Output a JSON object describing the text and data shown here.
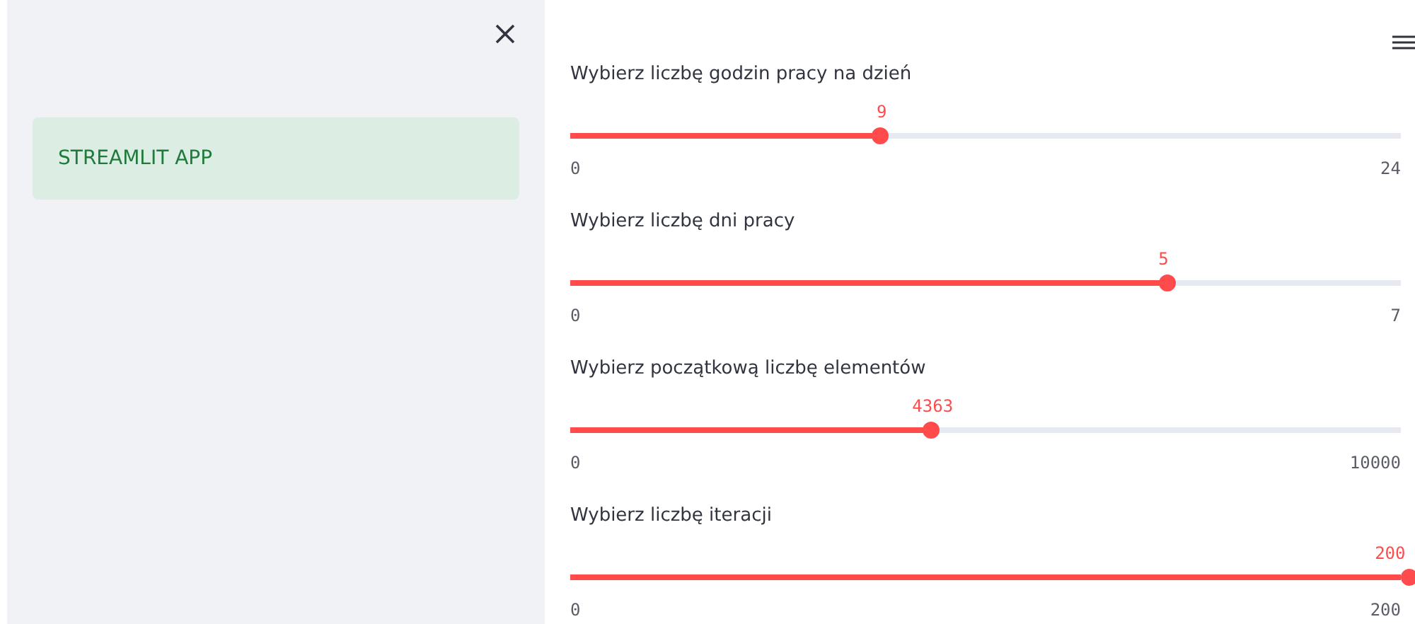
{
  "sidebar": {
    "items": [
      {
        "label": "STREAMLIT APP"
      }
    ]
  },
  "sliders": [
    {
      "label": "Wybierz liczbę godzin pracy na dzień",
      "value": "9",
      "min": "0",
      "max": "24",
      "level": 0.375
    },
    {
      "label": "Wybierz liczbę dni pracy",
      "value": "5",
      "min": "0",
      "max": "7",
      "level": 0.7143
    },
    {
      "label": "Wybierz początkową liczbę elementów",
      "value": "4363",
      "min": "0",
      "max": "10000",
      "level": 0.4363
    },
    {
      "label": "Wybierz liczbę iteracji",
      "value": "200",
      "min": "0",
      "max": "200",
      "level": 1
    }
  ]
}
